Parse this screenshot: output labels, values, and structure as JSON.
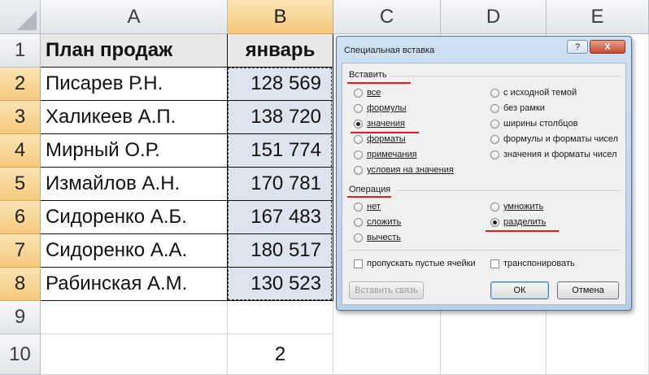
{
  "columns": [
    "A",
    "B",
    "C",
    "D",
    "E"
  ],
  "rows": [
    "1",
    "2",
    "3",
    "4",
    "5",
    "6",
    "7",
    "8",
    "9",
    "10"
  ],
  "table": {
    "header_name": "План продаж",
    "header_value": "январь",
    "names": [
      "Писарев Р.Н.",
      "Халикеев А.П.",
      "Мирный О.Р.",
      "Измайлов А.Н.",
      "Сидоренко А.Б.",
      "Сидоренко А.А.",
      "Рабинская А.М."
    ],
    "values": [
      "128 569",
      "138 720",
      "151 774",
      "170 781",
      "167 483",
      "180 517",
      "130 523"
    ]
  },
  "b10_value": "2",
  "dialog": {
    "title": "Специальная вставка",
    "help": "?",
    "close": "X",
    "paste_group": "Вставить",
    "paste_left": [
      "все",
      "формулы",
      "значения",
      "форматы",
      "примечания",
      "условия на значения"
    ],
    "paste_right": [
      "с исходной темой",
      "без рамки",
      "ширины столбцов",
      "формулы и форматы чисел",
      "значения и форматы чисел"
    ],
    "paste_selected": "значения",
    "operation_group": "Операция",
    "op_left": [
      "нет",
      "сложить",
      "вычесть"
    ],
    "op_right": [
      "умножить",
      "разделить"
    ],
    "op_selected": "разделить",
    "skip_blanks": "пропускать пустые ячейки",
    "transpose": "транспонировать",
    "paste_link_button": "Вставить связь",
    "ok_button": "ОК",
    "cancel_button": "Отмена"
  },
  "colors": {
    "header_selected": "#f5c97d",
    "selection": "#dde4ef",
    "annotation": "#e31b1b"
  }
}
